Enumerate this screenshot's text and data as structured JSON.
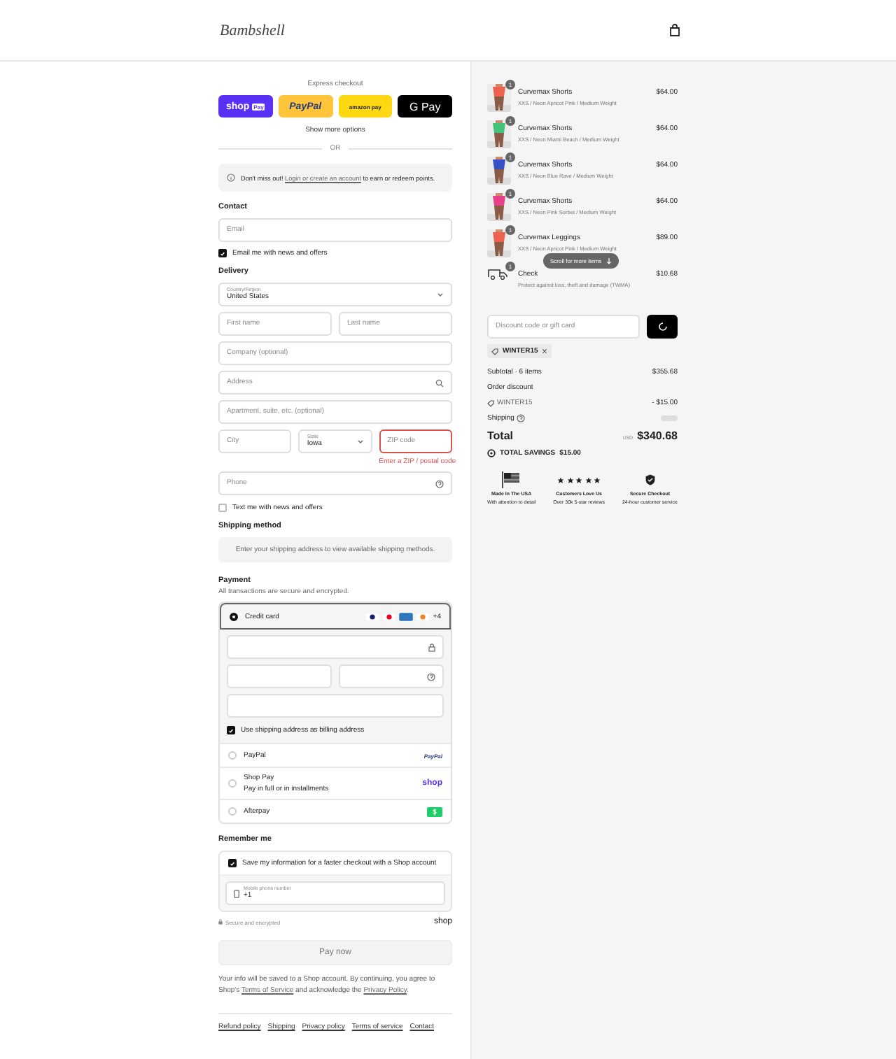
{
  "header": {
    "logo": "Bambshell"
  },
  "express": {
    "label": "Express checkout",
    "buttons": [
      {
        "kind": "shoppay",
        "label": "shop",
        "badge": "Pay"
      },
      {
        "kind": "paypal",
        "label": "PayPal"
      },
      {
        "kind": "amazon",
        "label": "amazon pay"
      },
      {
        "kind": "gpay",
        "label": "G Pay"
      }
    ],
    "more": "Show more options",
    "divider": "OR"
  },
  "notice": {
    "before": "Don't miss out!",
    "link": "Login or create an account",
    "after": "to earn or redeem points."
  },
  "contact": {
    "title": "Contact",
    "email": {
      "placeholder": "Email"
    },
    "news": {
      "label": "Email me with news and offers",
      "checked": true
    }
  },
  "delivery": {
    "title": "Delivery",
    "rows": [
      [
        {
          "kind": "select",
          "label": "Country/Region",
          "value": "United States"
        }
      ],
      [
        {
          "kind": "text",
          "placeholder": "First name"
        },
        {
          "kind": "text",
          "placeholder": "Last name"
        }
      ],
      [
        {
          "kind": "text",
          "placeholder": "Company (optional)"
        }
      ],
      [
        {
          "kind": "search",
          "placeholder": "Address"
        }
      ],
      [
        {
          "kind": "text",
          "placeholder": "Apartment, suite, etc. (optional)"
        }
      ],
      [
        {
          "kind": "text",
          "placeholder": "City"
        },
        {
          "kind": "select",
          "label": "State",
          "value": "Iowa"
        },
        {
          "kind": "text",
          "placeholder": "ZIP code",
          "error": "Enter a ZIP / postal code"
        }
      ],
      [
        {
          "kind": "help",
          "placeholder": "Phone"
        }
      ]
    ],
    "sms": {
      "label": "Text me with news and offers",
      "checked": false
    }
  },
  "shipping": {
    "title": "Shipping method",
    "message": "Enter your shipping address to view available shipping methods."
  },
  "payment": {
    "title": "Payment",
    "subtitle": "All transactions are secure and encrypted.",
    "methods": [
      {
        "kind": "card",
        "label": "Credit card",
        "selected": true,
        "more": "+4",
        "fields": [
          {
            "kind": "lock"
          },
          {
            "kind": "half"
          },
          {
            "kind": "help"
          },
          {
            "kind": "text"
          }
        ],
        "billing": {
          "label": "Use shipping address as billing address",
          "checked": true
        }
      },
      {
        "kind": "paypal",
        "label": "PayPal",
        "selected": false,
        "logo": "PayPal"
      },
      {
        "kind": "shop",
        "label": "Shop Pay",
        "sub": "Pay in full or in installments",
        "selected": false,
        "logo": "shop"
      },
      {
        "kind": "afterpay",
        "label": "Afterpay",
        "selected": false
      }
    ]
  },
  "remember": {
    "title": "Remember me",
    "save": {
      "label": "Save my information for a faster checkout with a Shop account",
      "checked": true
    },
    "phone": {
      "label": "Mobile phone number",
      "value": "+1"
    },
    "secure": "Secure and encrypted",
    "logo": "shop"
  },
  "pay_button": "Pay now",
  "legal": {
    "before": "Your info will be saved to a Shop account. By continuing, you agree to Shop's",
    "terms": "Terms of Service",
    "middle": "and acknowledge the",
    "privacy": "Privacy Policy",
    "end": "."
  },
  "footer_links": [
    "Refund policy",
    "Shipping",
    "Privacy policy",
    "Terms of service",
    "Contact"
  ],
  "cart": {
    "items": [
      {
        "kind": "picture",
        "qty": "1",
        "name": "Curvemax Shorts",
        "variant": "XXS / Neon Apricot Pink / Medium Weight",
        "price": "$64.00"
      },
      {
        "kind": "picture",
        "qty": "1",
        "name": "Curvemax Shorts",
        "variant": "XXS / Neon Miami Beach / Medium Weight",
        "price": "$64.00"
      },
      {
        "kind": "picture",
        "qty": "1",
        "name": "Curvemax Shorts",
        "variant": "XXS / Neon Blue Rave / Medium Weight",
        "price": "$64.00"
      },
      {
        "kind": "picture",
        "qty": "1",
        "name": "Curvemax Shorts",
        "variant": "XXS / Neon Pink Sorbet / Medium Weight",
        "price": "$64.00"
      },
      {
        "kind": "picture",
        "qty": "1",
        "name": "Curvemax Leggings",
        "variant": "XXS / Neon Apricot Pink / Medium Weight",
        "price": "$89.00"
      },
      {
        "kind": "protection",
        "qty": "1",
        "name": "Check",
        "variant": "Protect against loss, theft and damage (TWMA)",
        "price": "$10.68"
      }
    ],
    "scroll_hint": "Scroll for more items",
    "discount": {
      "placeholder": "Discount code or gift card"
    },
    "tag": "WINTER15",
    "subtotal": {
      "label": "Subtotal · 6 items",
      "value": "$355.68"
    },
    "order_discount": {
      "label": "Order discount",
      "code": "WINTER15",
      "value": "- $15.00"
    },
    "shipping": {
      "label": "Shipping"
    },
    "total": {
      "label": "Total",
      "currency": "USD",
      "value": "$340.68"
    },
    "savings": {
      "label": "TOTAL SAVINGS",
      "value": "$15.00"
    },
    "badges": [
      {
        "kind": "flag",
        "title": "Made In The USA",
        "sub": "With attention to detail"
      },
      {
        "kind": "stars",
        "stars": 5,
        "title": "Customers Love Us",
        "sub": "Over 30k 5-star reviews"
      },
      {
        "kind": "shield",
        "title": "Secure Checkout",
        "sub": "24-hour customer service"
      }
    ]
  }
}
